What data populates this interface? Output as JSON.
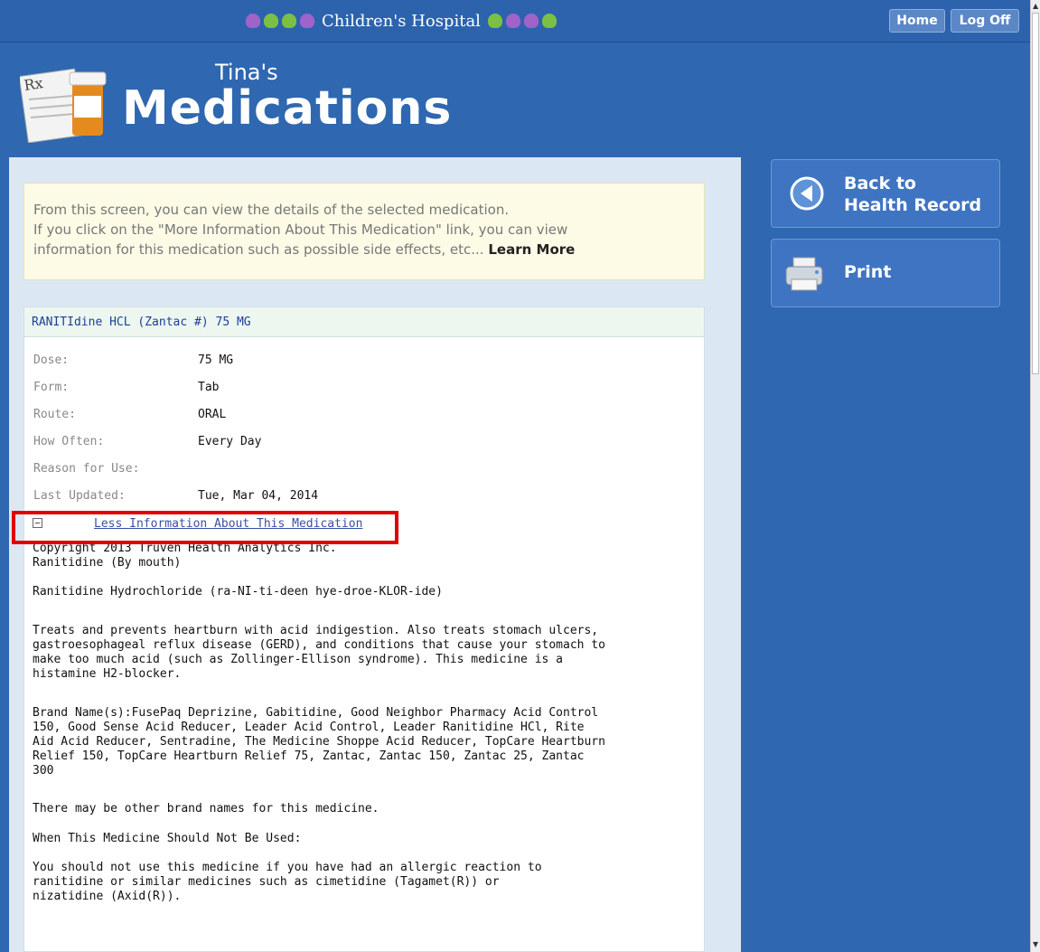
{
  "header": {
    "hospital_name": "Children's Hospital",
    "patient_name": "Tina's",
    "page_title": "Medications",
    "home_label": "Home",
    "logoff_label": "Log Off"
  },
  "info_box": {
    "line1": "From this screen, you can view the details of the selected medication.",
    "line2": "If you click on the \"More Information About This Medication\" link, you can view",
    "line3": "information for this medication such as possible side effects, etc...",
    "learn_more": "Learn More"
  },
  "medication": {
    "title": "RANITIdine HCL (Zantac #) 75 MG",
    "details": [
      {
        "label": "Dose:",
        "value": "75 MG"
      },
      {
        "label": "Form:",
        "value": "Tab"
      },
      {
        "label": "Route:",
        "value": "ORAL"
      },
      {
        "label": "How Often:",
        "value": "Every Day"
      },
      {
        "label": "Reason for Use:",
        "value": ""
      },
      {
        "label": "Last Updated:",
        "value": "Tue, Mar 04, 2014"
      }
    ],
    "toggle_label": "Less Information About This Medication",
    "monograph": {
      "copyright": "Copyright 2013 Truven Health Analytics Inc.",
      "name_route": "Ranitidine (By mouth)",
      "pronunciation": "Ranitidine Hydrochloride (ra-NI-ti-deen hye-droe-KLOR-ide)",
      "uses": "Treats and prevents heartburn with acid indigestion. Also treats stomach ulcers, gastroesophageal reflux disease (GERD), and conditions that cause your stomach to make too much acid (such as Zollinger-Ellison syndrome). This medicine is a histamine H2-blocker.",
      "brands": "Brand Name(s):FusePaq Deprizine, Gabitidine, Good Neighbor Pharmacy Acid Control 150, Good Sense Acid Reducer, Leader Acid Control, Leader Ranitidine HCl, Rite Aid Acid Reducer, Sentradine, The Medicine Shoppe Acid Reducer, TopCare Heartburn Relief 150, TopCare Heartburn Relief 75, Zantac, Zantac 150, Zantac 25, Zantac 300",
      "other_brands": "There may be other brand names for this medicine.",
      "not_used_heading": "When This Medicine Should Not Be Used:",
      "not_used_text": "You should not use this medicine if you have had an allergic reaction to ranitidine or similar medicines such as cimetidine (Tagamet(R)) or nizatidine (Axid(R))."
    }
  },
  "sidebar": {
    "back_label_1": "Back to",
    "back_label_2": "Health Record",
    "print_label": "Print"
  },
  "colors": {
    "background": "#2f67b0",
    "panel": "#dbe8f3",
    "highlight_box": "#e00000"
  }
}
